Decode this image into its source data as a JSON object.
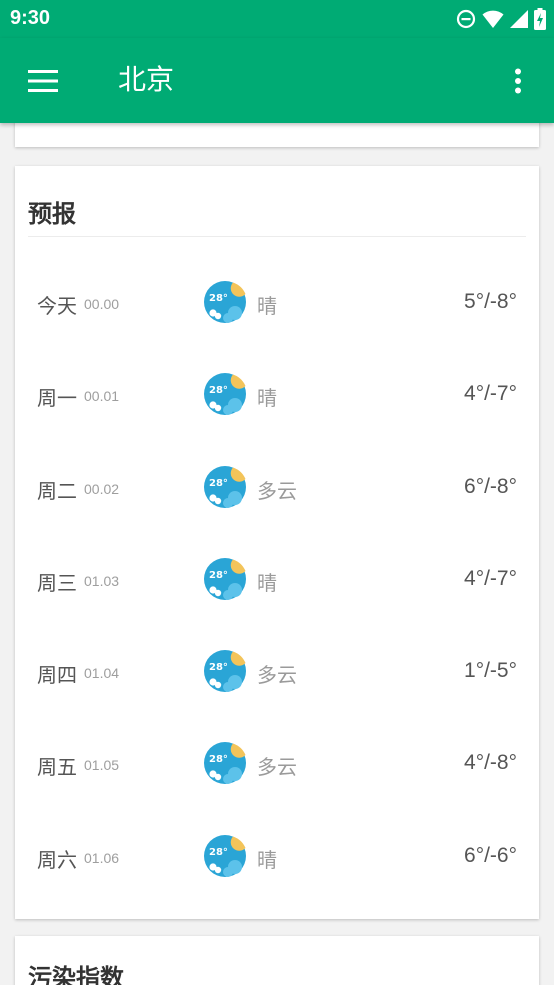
{
  "status_bar": {
    "time": "9:30"
  },
  "app_bar": {
    "title": "北京"
  },
  "forecast": {
    "title": "预报",
    "rows": [
      {
        "day": "今天",
        "date": "00.00",
        "icon_temp": "28°",
        "condition": "晴",
        "temp": "5°/-8°"
      },
      {
        "day": "周一",
        "date": "00.01",
        "icon_temp": "28°",
        "condition": "晴",
        "temp": "4°/-7°"
      },
      {
        "day": "周二",
        "date": "00.02",
        "icon_temp": "28°",
        "condition": "多云",
        "temp": "6°/-8°"
      },
      {
        "day": "周三",
        "date": "01.03",
        "icon_temp": "28°",
        "condition": "晴",
        "temp": "4°/-7°"
      },
      {
        "day": "周四",
        "date": "01.04",
        "icon_temp": "28°",
        "condition": "多云",
        "temp": "1°/-5°"
      },
      {
        "day": "周五",
        "date": "01.05",
        "icon_temp": "28°",
        "condition": "多云",
        "temp": "4°/-8°"
      },
      {
        "day": "周六",
        "date": "01.06",
        "icon_temp": "28°",
        "condition": "晴",
        "temp": "6°/-6°"
      }
    ]
  },
  "pollution": {
    "title": "污染指数"
  },
  "colors": {
    "primary": "#00ab74",
    "icon_blue": "#2aa5d6",
    "icon_sun": "#f3c45a"
  }
}
